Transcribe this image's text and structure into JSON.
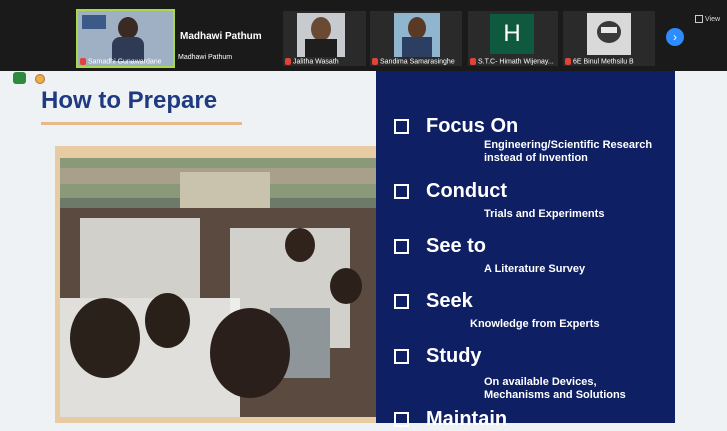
{
  "meeting": {
    "speaker_name": "Madhawi Pathum",
    "participants": [
      {
        "name": "Samadhi Gunawardane"
      },
      {
        "name": "Madhawi Pathum"
      },
      {
        "name": "Jalitha Wasath"
      },
      {
        "name": "Sandima Samarasinghe"
      },
      {
        "name": "S.T.C- Himath Wijenay..."
      },
      {
        "name": "6E Binul Methsilu B"
      }
    ],
    "h_avatar_letter": "H",
    "view_label": "View",
    "next_icon": "›"
  },
  "slide": {
    "title": "How to Prepare",
    "items": [
      {
        "heading": "Focus On",
        "sub": [
          "Engineering/Scientific Research",
          "instead of Invention"
        ]
      },
      {
        "heading": "Conduct",
        "sub": [
          "Trials and Experiments"
        ]
      },
      {
        "heading": "See to",
        "sub": [
          "A Literature Survey"
        ]
      },
      {
        "heading": "Seek",
        "sub": [
          "Knowledge from Experts"
        ]
      },
      {
        "heading": "Study",
        "sub": [
          "On available Devices,",
          "Mechanisms and Solutions"
        ]
      },
      {
        "heading": "Maintain",
        "sub": []
      }
    ]
  },
  "colors": {
    "panel": "#0f1f63",
    "title": "#1f3a80",
    "accent": "#e6b98a",
    "active_tile": "#a9d94a"
  }
}
